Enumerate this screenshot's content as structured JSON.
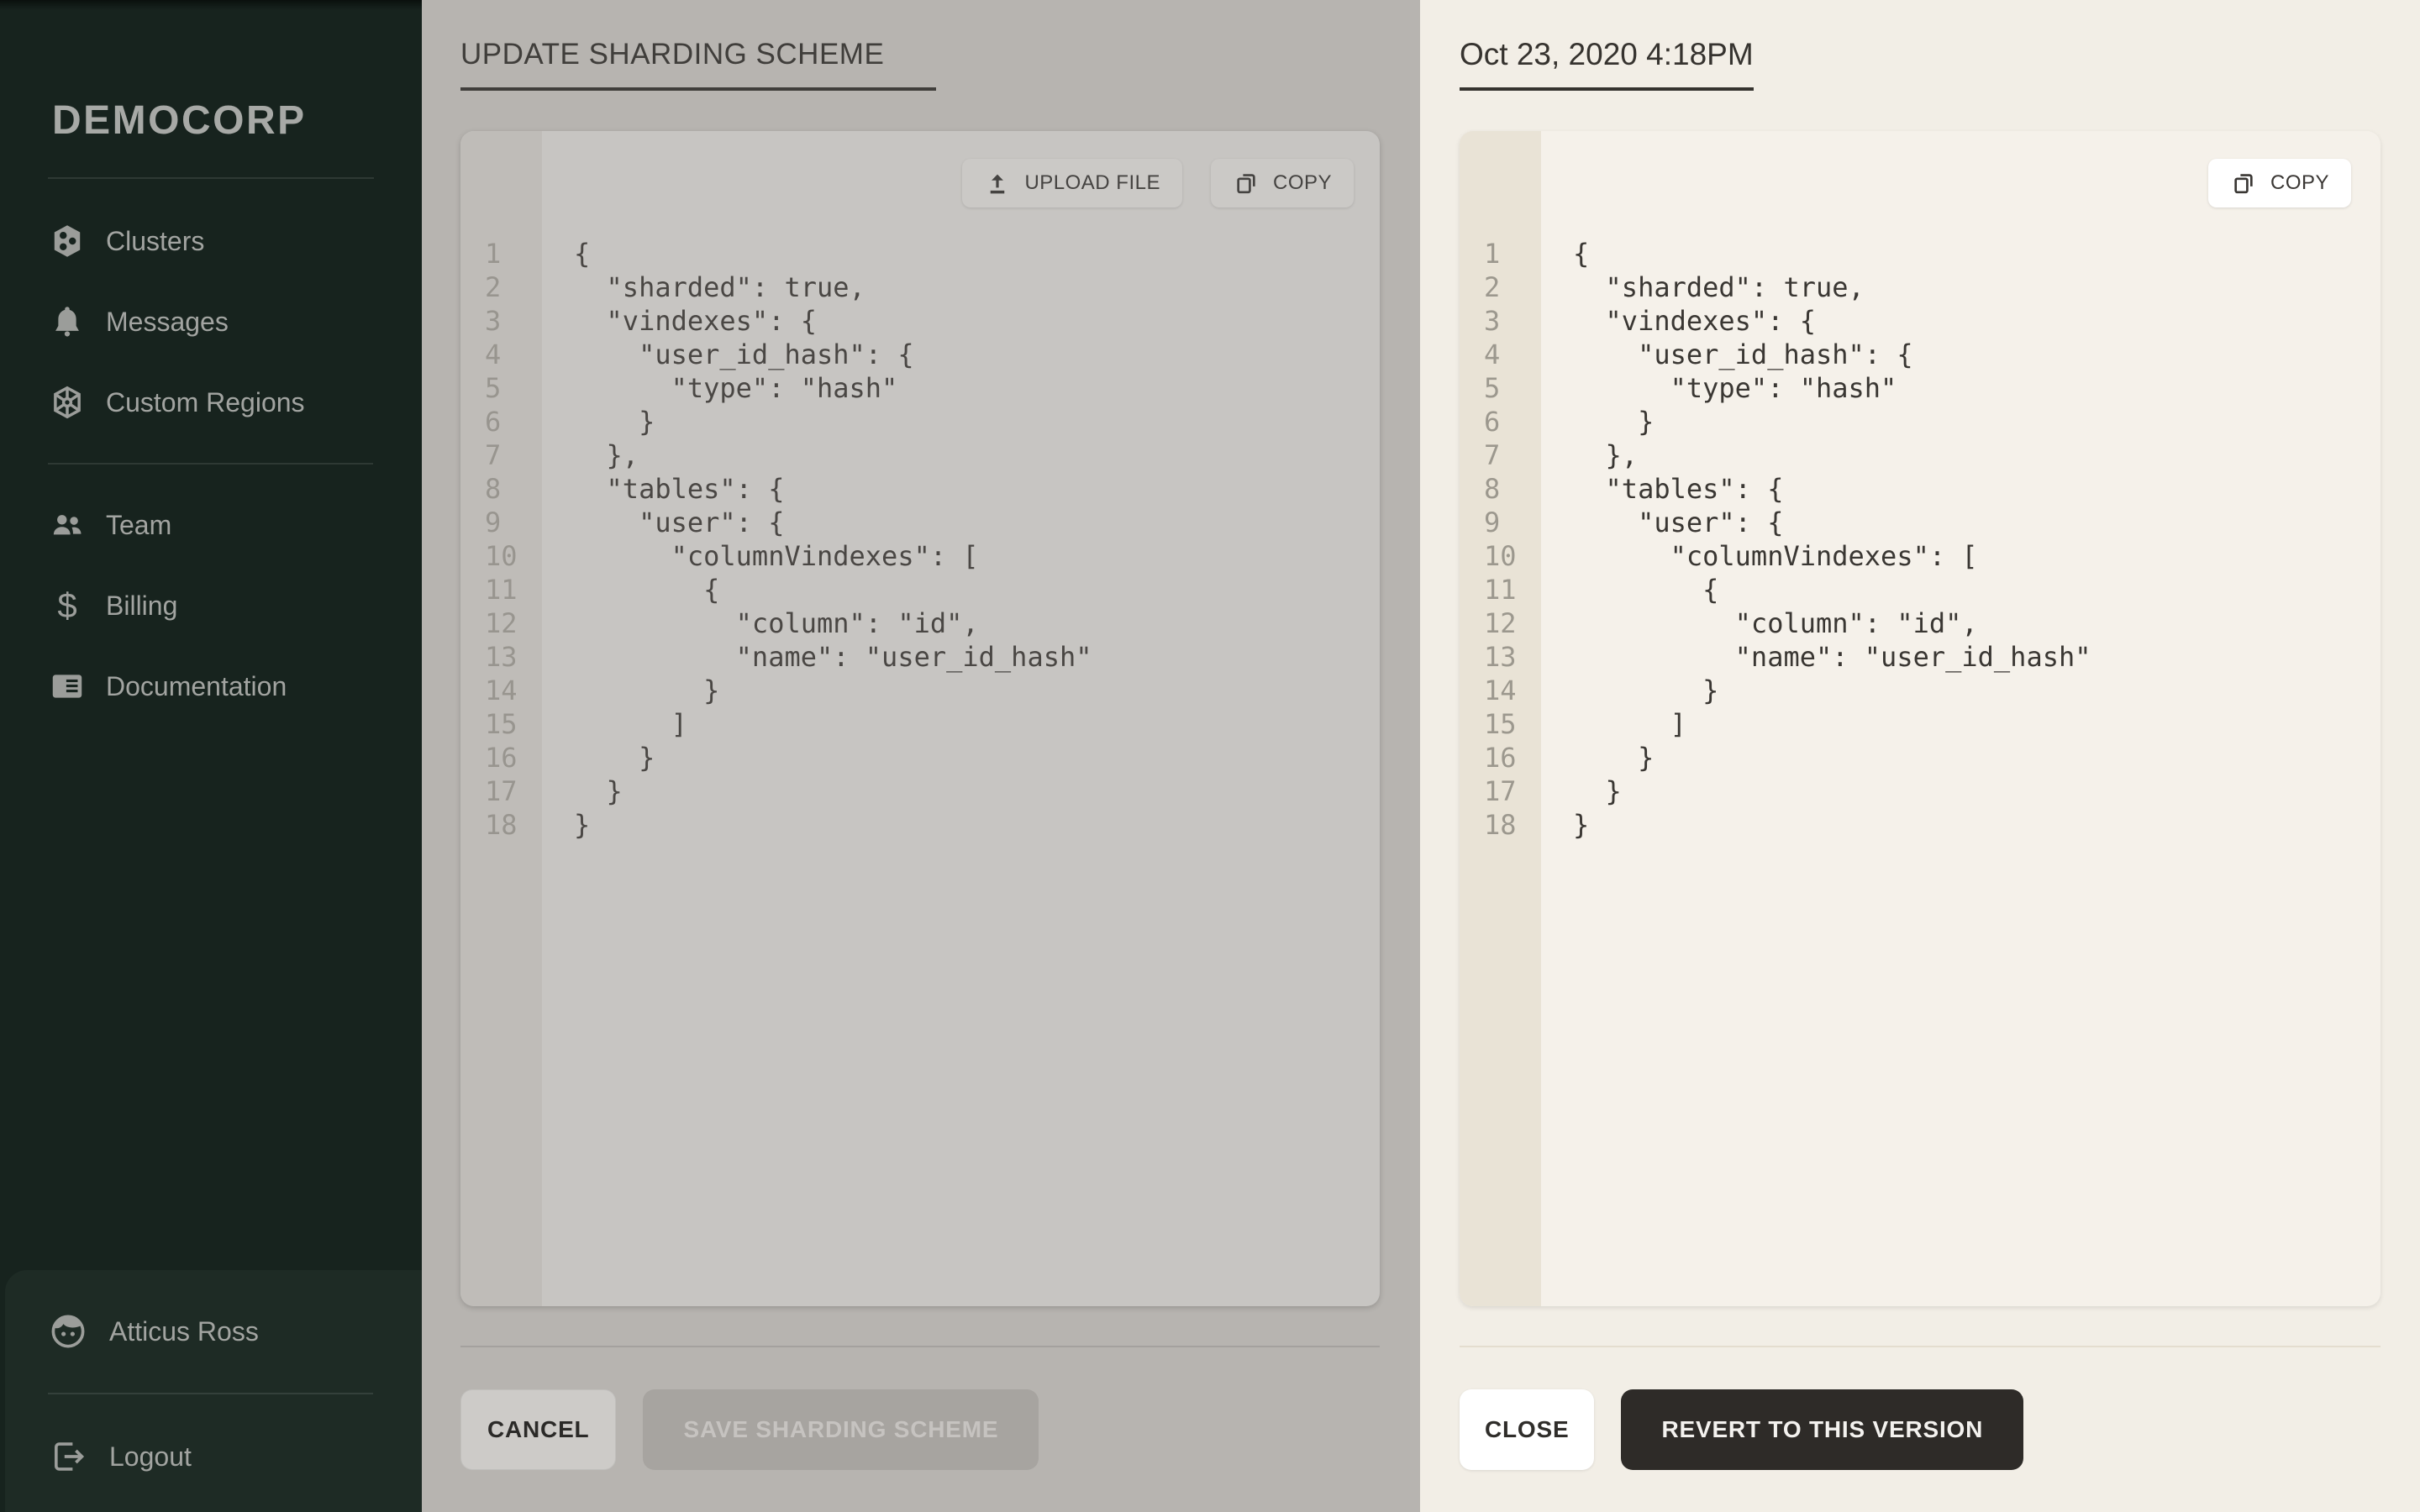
{
  "sidebar": {
    "brand": "DEMOCORP",
    "nav_primary": [
      {
        "label": "Clusters",
        "icon": "clusters-hexagon-icon"
      },
      {
        "label": "Messages",
        "icon": "bell-icon"
      },
      {
        "label": "Custom Regions",
        "icon": "region-hexagon-icon"
      }
    ],
    "nav_secondary": [
      {
        "label": "Team",
        "icon": "people-icon"
      },
      {
        "label": "Billing",
        "icon": "dollar-icon"
      },
      {
        "label": "Documentation",
        "icon": "document-icon"
      }
    ],
    "user": {
      "name": "Atticus Ross",
      "icon": "face-icon"
    },
    "logout_label": "Logout"
  },
  "editor_panel": {
    "title": "UPDATE SHARDING SCHEME",
    "upload_button": "UPLOAD FILE",
    "copy_button": "COPY",
    "cancel_button": "CANCEL",
    "save_button": "SAVE SHARDING SCHEME",
    "save_disabled": true,
    "code_lines": [
      "{",
      "  \"sharded\": true,",
      "  \"vindexes\": {",
      "    \"user_id_hash\": {",
      "      \"type\": \"hash\"",
      "    }",
      "  },",
      "  \"tables\": {",
      "    \"user\": {",
      "      \"columnVindexes\": [",
      "        {",
      "          \"column\": \"id\",",
      "          \"name\": \"user_id_hash\"",
      "        }",
      "      ]",
      "    }",
      "  }",
      "}"
    ]
  },
  "version_panel": {
    "title": "Oct 23, 2020 4:18PM",
    "copy_button": "COPY",
    "close_button": "CLOSE",
    "revert_button": "REVERT TO THIS VERSION",
    "code_lines": [
      "{",
      "  \"sharded\": true,",
      "  \"vindexes\": {",
      "    \"user_id_hash\": {",
      "      \"type\": \"hash\"",
      "    }",
      "  },",
      "  \"tables\": {",
      "    \"user\": {",
      "      \"columnVindexes\": [",
      "        {",
      "          \"column\": \"id\",",
      "          \"name\": \"user_id_hash\"",
      "        }",
      "      ]",
      "    }",
      "  }",
      "}"
    ]
  },
  "colors": {
    "sidebar_bg": "#17231e",
    "sidebar_card_bg": "#1e2b25",
    "sidebar_text": "#a2a4a1",
    "dimmed_panel_bg": "#b7b4b0",
    "dimmed_code_bg": "#c7c5c2",
    "dimmed_gutter_bg": "#bfbcb8",
    "version_panel_bg": "#f2eee6",
    "version_code_bg": "#f5f1ea",
    "version_gutter_bg": "#e9e3d6",
    "revert_button_bg": "#2e2b28",
    "revert_button_text": "#f4f2ef"
  }
}
